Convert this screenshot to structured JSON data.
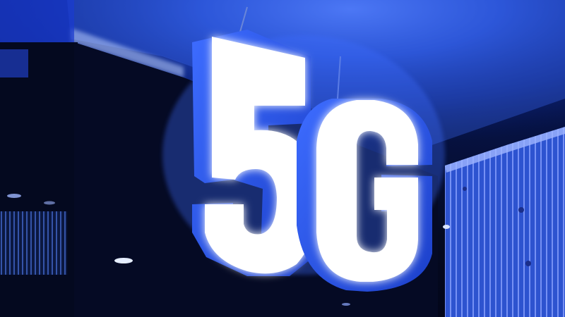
{
  "sign": {
    "text_digit": "5",
    "text_letter": "G"
  },
  "colors": {
    "ceiling_light": "#3f6fff",
    "ceiling_dark": "#0a1d6b",
    "wall_dark": "#03061a",
    "letter_face": "#ffffff",
    "letter_side": "#2a55e8",
    "letter_glow": "#7fa3ff",
    "panel_blue": "#2f57d8",
    "panel_stripe": "#6f8dff"
  }
}
